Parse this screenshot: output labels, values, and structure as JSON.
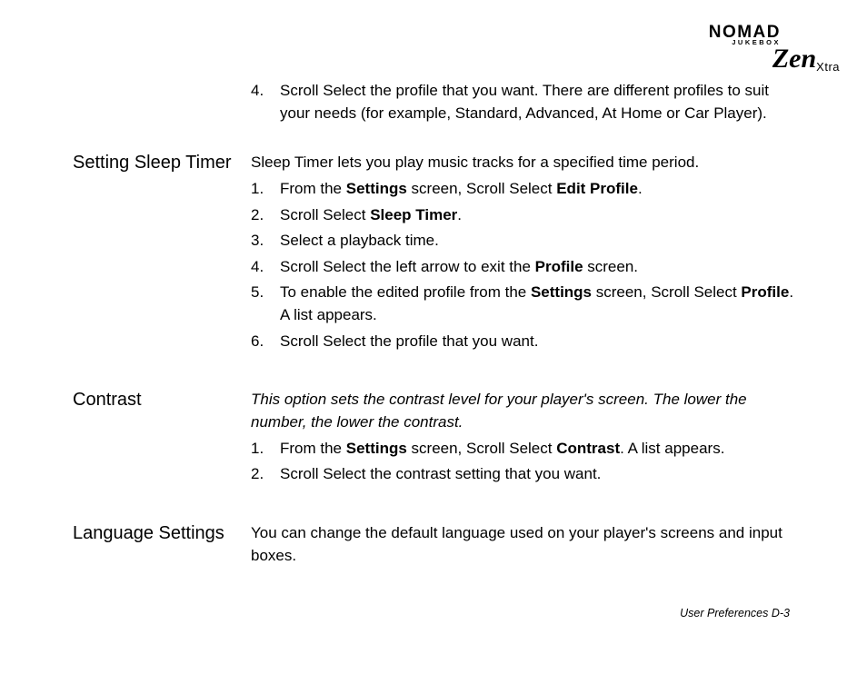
{
  "logo": {
    "brand": "NOMAD",
    "sub": "JUKEBOX",
    "zen": "Zen",
    "xtra": "Xtra"
  },
  "top_step": {
    "num": "4.",
    "text": "Scroll Select the profile that you want. There are different profiles to suit your needs (for example, Standard, Advanced, At Home or Car Player)."
  },
  "sleep": {
    "heading": "Setting Sleep Timer",
    "intro": "Sleep Timer lets you play music tracks for a specified time period.",
    "s1a": "From the ",
    "s1b": "Settings",
    "s1c": " screen, Scroll Select ",
    "s1d": "Edit Profile",
    "s1e": ".",
    "s2a": "Scroll Select ",
    "s2b": "Sleep Timer",
    "s2c": ".",
    "s3": "Select a playback time.",
    "s4a": "Scroll Select the left arrow to exit the ",
    "s4b": "Profile",
    "s4c": " screen.",
    "s5a": "To enable the edited profile from the ",
    "s5b": "Settings",
    "s5c": " screen, Scroll Select ",
    "s5d": "Profile",
    "s5e": ". A list appears.",
    "s6": "Scroll Select the profile that you want."
  },
  "contrast": {
    "heading": "Contrast",
    "intro": "This option sets the contrast level for your player's screen. The lower the number, the lower the contrast.",
    "s1a": "From the ",
    "s1b": "Settings",
    "s1c": " screen, Scroll Select ",
    "s1d": "Contrast",
    "s1e": ". A list appears.",
    "s2": "Scroll Select the contrast setting that you want."
  },
  "lang": {
    "heading": "Language Settings",
    "intro": "You can change the default language used on your player's screens and input boxes."
  },
  "footer": "User Preferences D-3"
}
